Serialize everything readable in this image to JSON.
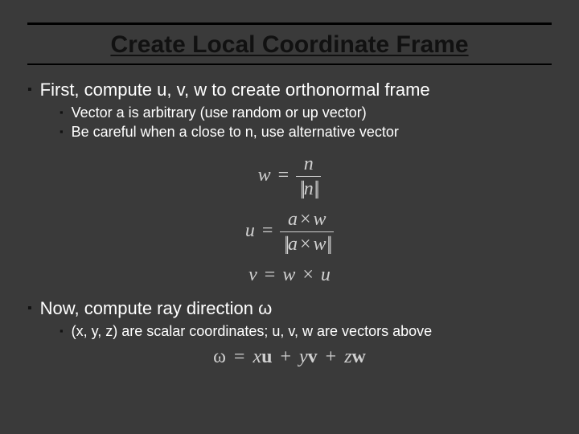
{
  "title": "Create Local Coordinate Frame",
  "bullets": {
    "b1": "First, compute u, v, w to create orthonormal frame",
    "b1a": "Vector a is arbitrary (use random or up vector)",
    "b1b": "Be careful when a close to n, use alternative vector",
    "b2": "Now, compute ray direction ω",
    "b2a": "(x, y, z) are scalar coordinates; u, v, w are vectors above"
  },
  "eq": {
    "w_lhs": "w",
    "w_num": "n",
    "w_den": "n",
    "u_lhs": "u",
    "u_num_a": "a",
    "u_num_w": "w",
    "u_den_a": "a",
    "u_den_w": "w",
    "v_lhs": "v",
    "v_rhs_w": "w",
    "v_rhs_u": "u",
    "omega": "ω",
    "x": "x",
    "y": "y",
    "z": "z",
    "uu": "u",
    "vv": "v",
    "ww": "w",
    "eq_sign": "=",
    "plus": "+",
    "times": "×"
  }
}
